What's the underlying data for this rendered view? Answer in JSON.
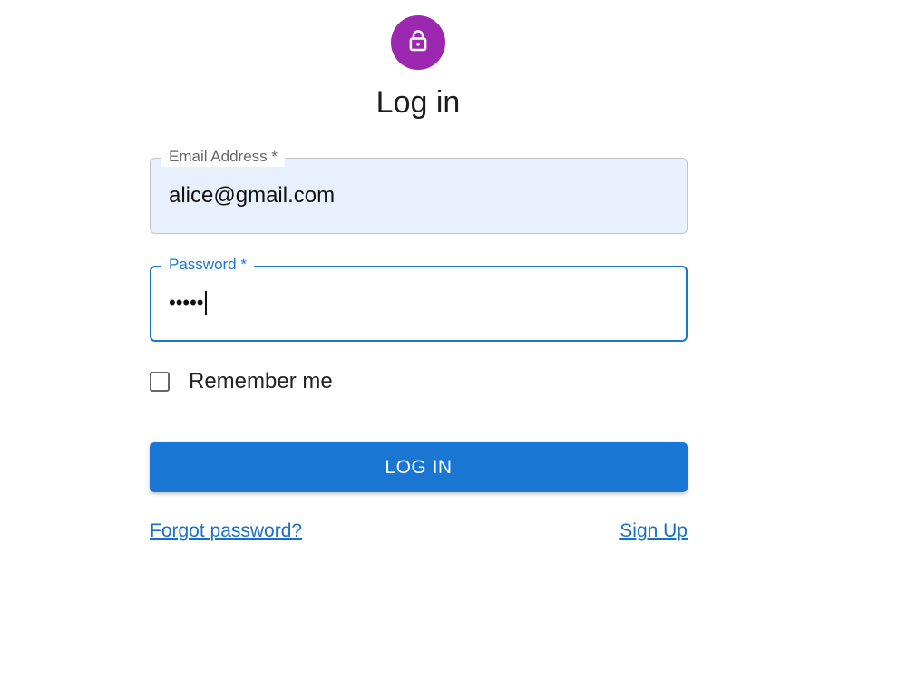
{
  "colors": {
    "avatar_bg": "#9c27b0",
    "primary": "#1976d2",
    "link": "#1a6fc4"
  },
  "header": {
    "icon": "lock-icon",
    "title": "Log in"
  },
  "form": {
    "email": {
      "label": "Email Address *",
      "value": "alice@gmail.com"
    },
    "password": {
      "label": "Password *",
      "masked_value": "•••••"
    },
    "remember": {
      "label": "Remember me",
      "checked": false
    },
    "submit_label": "LOG IN"
  },
  "links": {
    "forgot": "Forgot password?",
    "signup": "Sign Up"
  }
}
